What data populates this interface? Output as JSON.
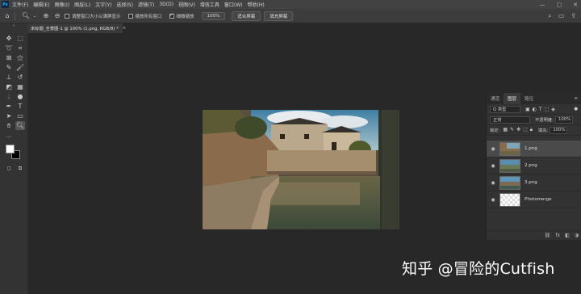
{
  "app": {
    "logo": "Ps"
  },
  "menubar": {
    "items": [
      "文件(F)",
      "编辑(E)",
      "图像(I)",
      "图层(L)",
      "文字(Y)",
      "选择(S)",
      "滤镜(T)",
      "3D(D)",
      "视图(V)",
      "增效工具",
      "窗口(W)",
      "帮助(H)"
    ],
    "window_controls": [
      "—",
      "▢",
      "✕"
    ]
  },
  "options_bar": {
    "checkbox_resize": {
      "label": "调整窗口大小以满屏显示",
      "checked": false
    },
    "checkbox_zoom_all": {
      "label": "缩放所有窗口",
      "checked": false
    },
    "checkbox_scrubby": {
      "label": "细微缩放",
      "checked": true
    },
    "zoom_value": "100%",
    "fit_screen": "适合屏幕",
    "fill_screen": "填充屏幕"
  },
  "document_tab": {
    "title": "未标题_全景图-1 @ 100% (1.png, RGB/8) *",
    "close": "×"
  },
  "layers_panel": {
    "tabs": [
      "通道",
      "图层",
      "路径"
    ],
    "active_tab": "图层",
    "filter_kind": "Q 类型",
    "blend_mode": "正常",
    "opacity_label": "不透明度:",
    "opacity_value": "100%",
    "lock_label": "锁定:",
    "fill_label": "填充:",
    "fill_value": "100%",
    "layers": [
      {
        "name": "1.png",
        "selected": true
      },
      {
        "name": "2.png",
        "selected": false
      },
      {
        "name": "3.png",
        "selected": false
      },
      {
        "name": "Photomerge",
        "selected": false
      }
    ],
    "footer_icons": [
      "link-icon",
      "fx-icon",
      "mask-icon",
      "adjustment-icon"
    ]
  },
  "watermark": {
    "text": "知乎 @冒险的Cutfish"
  },
  "colors": {
    "menubar": "#424242",
    "canvas": "#282828",
    "panel": "#323232"
  }
}
